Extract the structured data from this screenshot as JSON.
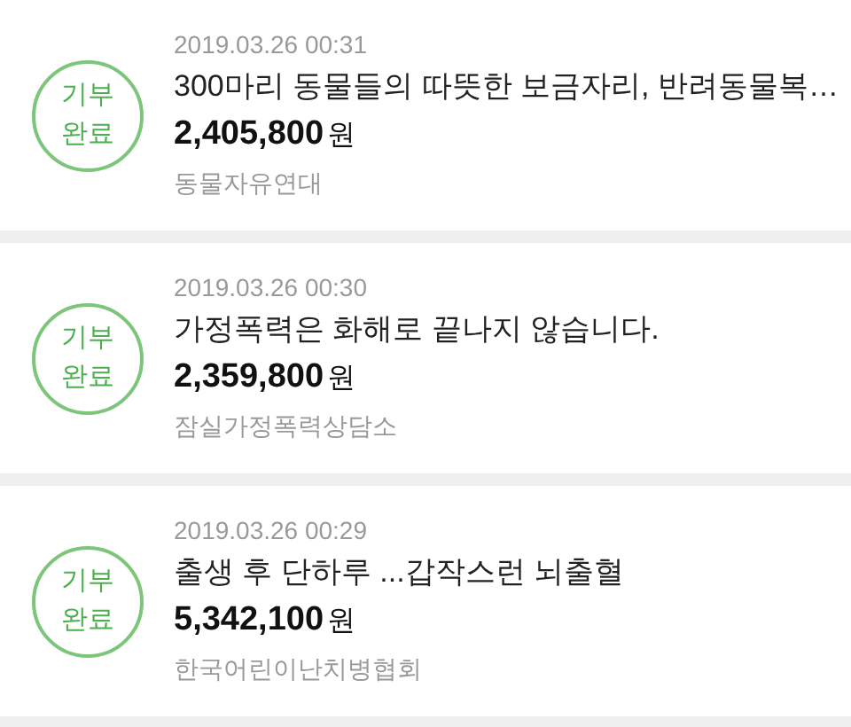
{
  "donations": [
    {
      "badge": "기부 완료",
      "date": "2019.03.26 00:31",
      "title": "300마리 동물들의 따뜻한 보금자리, 반려동물복…",
      "amount": "2,405,800",
      "unit": "원",
      "organization": "동물자유연대"
    },
    {
      "badge": "기부 완료",
      "date": "2019.03.26 00:30",
      "title": "가정폭력은 화해로 끝나지 않습니다.",
      "amount": "2,359,800",
      "unit": "원",
      "organization": "잠실가정폭력상담소"
    },
    {
      "badge": "기부 완료",
      "date": "2019.03.26 00:29",
      "title": "출생 후 단하루 ...갑작스런 뇌출혈",
      "amount": "5,342,100",
      "unit": "원",
      "organization": "한국어린이난치병협회"
    }
  ]
}
